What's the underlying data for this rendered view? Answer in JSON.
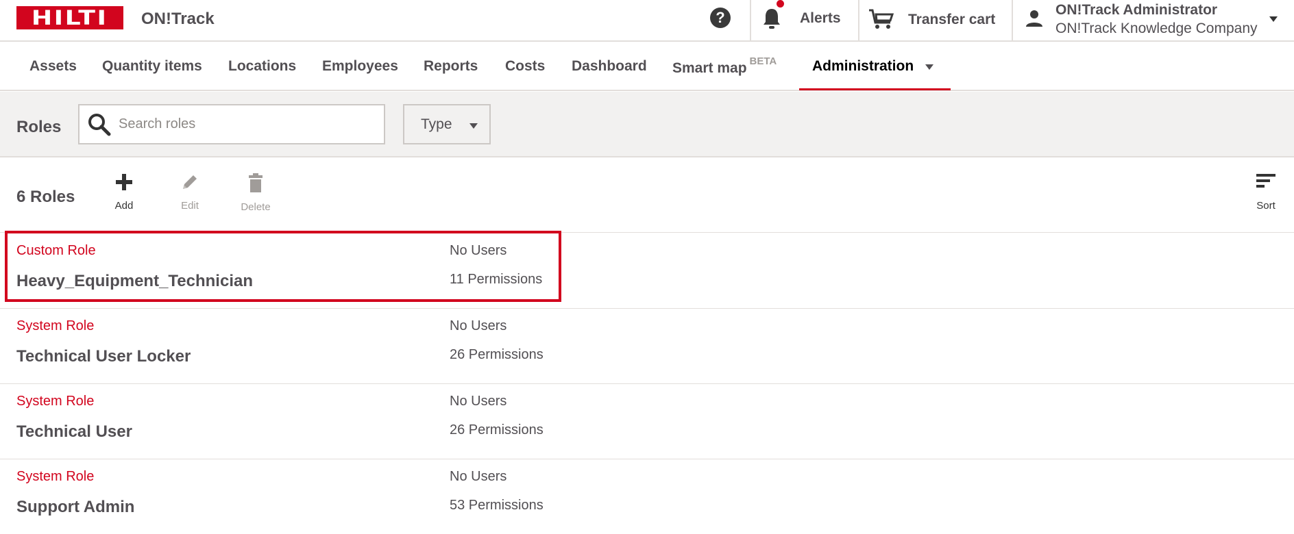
{
  "header": {
    "logo_text": "HILTI",
    "app_name": "ON!Track",
    "help_icon": "?",
    "alerts_label": "Alerts",
    "cart_label": "Transfer cart",
    "user_name": "ON!Track Administrator",
    "user_company": "ON!Track Knowledge Company",
    "brand_color": "#d2051e"
  },
  "nav": {
    "items": [
      {
        "label": "Assets"
      },
      {
        "label": "Quantity items"
      },
      {
        "label": "Locations"
      },
      {
        "label": "Employees"
      },
      {
        "label": "Reports"
      },
      {
        "label": "Costs"
      },
      {
        "label": "Dashboard"
      },
      {
        "label": "Smart map",
        "badge": "BETA"
      },
      {
        "label": "Administration",
        "active": true
      }
    ]
  },
  "filter": {
    "title": "Roles",
    "search_placeholder": "Search roles",
    "search_value": "",
    "type_label": "Type"
  },
  "toolbar": {
    "count_label": "6 Roles",
    "add_label": "Add",
    "edit_label": "Edit",
    "delete_label": "Delete",
    "sort_label": "Sort"
  },
  "roles": [
    {
      "type": "Custom Role",
      "name": "Heavy_Equipment_Technician",
      "users": "No Users",
      "permissions": "11 Permissions",
      "highlighted": true
    },
    {
      "type": "System Role",
      "name": "Technical User Locker",
      "users": "No Users",
      "permissions": "26 Permissions"
    },
    {
      "type": "System Role",
      "name": "Technical User",
      "users": "No Users",
      "permissions": "26 Permissions"
    },
    {
      "type": "System Role",
      "name": "Support Admin",
      "users": "No Users",
      "permissions": "53 Permissions"
    }
  ]
}
